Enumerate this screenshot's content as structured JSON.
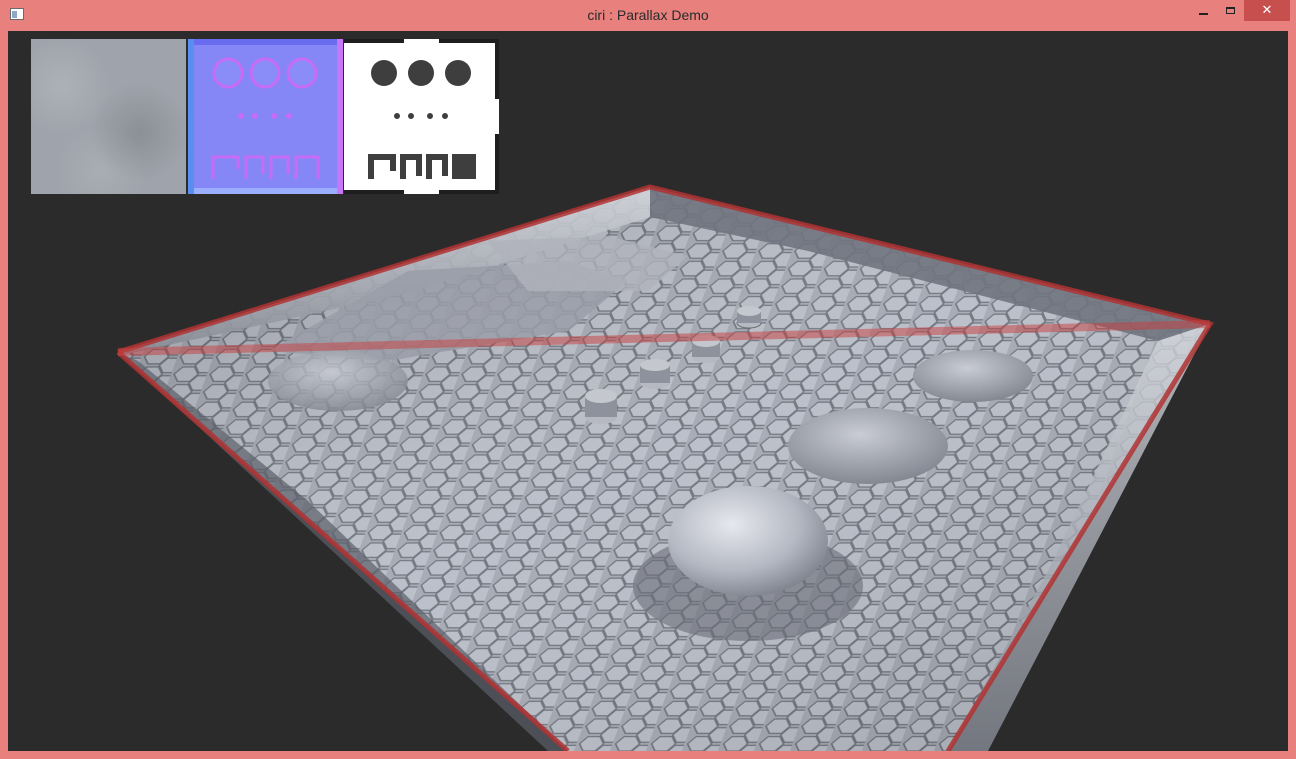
{
  "window": {
    "title": "ciri : Parallax Demo",
    "app_icon": "application-icon",
    "buttons": {
      "minimize_icon": "minimize-icon",
      "maximize_icon": "maximize-icon",
      "close_label": "✕"
    }
  },
  "colors": {
    "frame": "#e8817e",
    "close_button": "#c7504f",
    "viewport_background": "#2b2b2b",
    "wall_outline": "#b03232",
    "floor_tile": "#9a9ea8",
    "normal_map": "#8587f6"
  },
  "textures": [
    {
      "id": "diffuse",
      "kind": "diffuse-map"
    },
    {
      "id": "normal",
      "kind": "normal-map"
    },
    {
      "id": "height",
      "kind": "height-map"
    }
  ]
}
